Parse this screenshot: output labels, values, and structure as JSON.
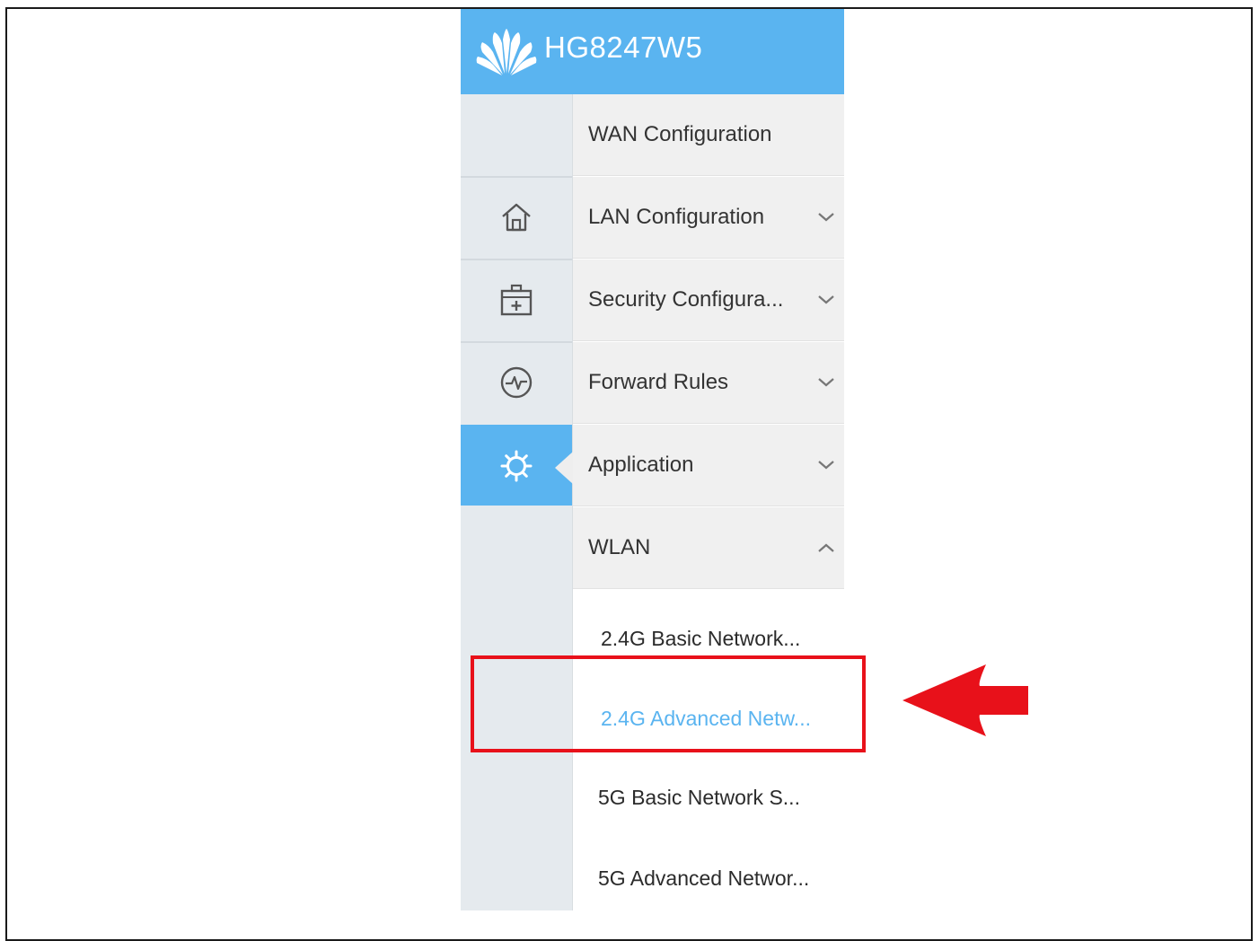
{
  "colors": {
    "header_bg": "#5ab4f0",
    "accent": "#5ab4f0",
    "highlight_border": "#e8111a",
    "arrow": "#e8111a"
  },
  "header": {
    "logo_icon": "huawei-logo",
    "model": "HG8247W5"
  },
  "rail": {
    "items": [
      {
        "icon": "home-icon"
      },
      {
        "icon": "first-aid-kit-icon"
      },
      {
        "icon": "heartbeat-icon"
      },
      {
        "icon": "gear-icon",
        "active": true
      }
    ]
  },
  "menu": {
    "items": [
      {
        "label": "WAN Configuration",
        "chevron": "none"
      },
      {
        "label": "LAN Configuration",
        "chevron": "chevron-down-icon"
      },
      {
        "label": "Security Configura...",
        "chevron": "chevron-down-icon"
      },
      {
        "label": "Forward Rules",
        "chevron": "chevron-down-icon"
      },
      {
        "label": "Application",
        "chevron": "chevron-down-icon"
      },
      {
        "label": "WLAN",
        "chevron": "chevron-up-icon",
        "expanded": true
      }
    ],
    "wlan_submenu": [
      {
        "label": "2.4G Basic Network...",
        "active": false
      },
      {
        "label": "2.4G Advanced Netw...",
        "active": true
      },
      {
        "label": "5G Basic Network S...",
        "active": false
      },
      {
        "label": "5G Advanced Networ...",
        "active": false
      }
    ]
  },
  "annotation": {
    "highlight": "red-box",
    "pointer": "red-arrow-left"
  }
}
